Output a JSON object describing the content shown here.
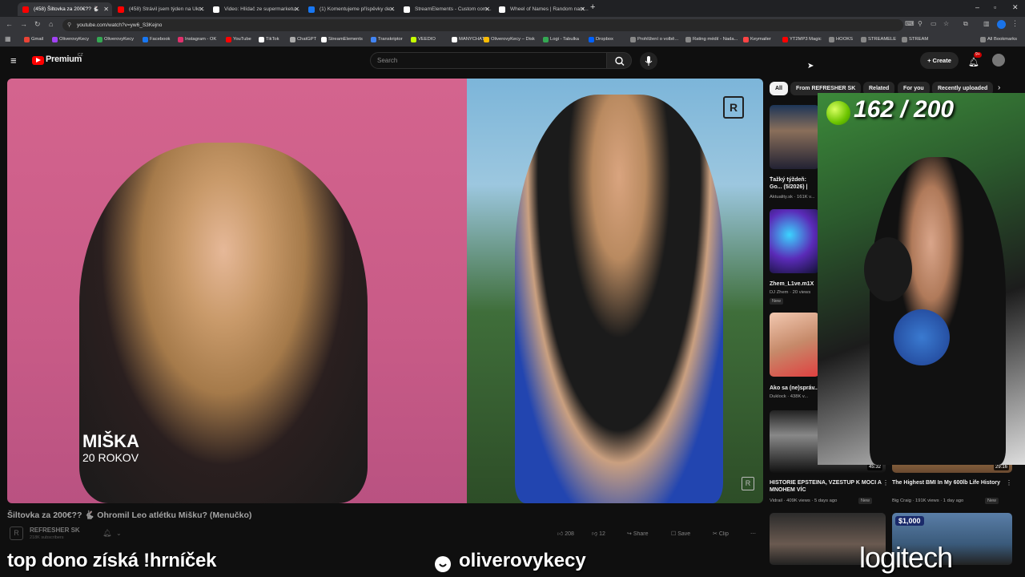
{
  "browser": {
    "tabs": [
      {
        "title": "(458) Šiltovka za 200€?? 🐇",
        "active": true,
        "color": "#ff0000"
      },
      {
        "title": "(458) Strávil jsem týden na Ukr...",
        "active": false,
        "color": "#ff0000"
      },
      {
        "title": "Video: Hlídač ze supermarketu...",
        "active": false,
        "color": "#ffffff"
      },
      {
        "title": "(1) Komentujeme příspěvky de...",
        "active": false,
        "color": "#1877f2"
      },
      {
        "title": "StreamElements - Custom com...",
        "active": false,
        "color": "#ffffff"
      },
      {
        "title": "Wheel of Names | Random nam...",
        "active": false,
        "color": "#ffffff"
      }
    ],
    "new_tab": "+",
    "url": "youtube.com/watch?v=yw6_S3Kejno",
    "bookmarks": [
      {
        "label": "Gmail",
        "color": "#ea4335"
      },
      {
        "label": "OliverovyKecy",
        "color": "#a142f4"
      },
      {
        "label": "OliverovyKecy",
        "color": "#34a853"
      },
      {
        "label": "Facebook",
        "color": "#1877f2"
      },
      {
        "label": "Instagram - OK",
        "color": "#e1306c"
      },
      {
        "label": "YouTube",
        "color": "#ff0000"
      },
      {
        "label": "TikTok",
        "color": "#ffffff"
      },
      {
        "label": "ChatGPT",
        "color": "#aaaaaa"
      },
      {
        "label": "StreamElements",
        "color": "#ffffff"
      },
      {
        "label": "Transkriptor",
        "color": "#4285f4"
      },
      {
        "label": "VEEDIO",
        "color": "#c6ff00"
      },
      {
        "label": "MANYCHAT",
        "color": "#ffffff"
      },
      {
        "label": "OliverovyKecy – Disk",
        "color": "#fbbc04"
      },
      {
        "label": "Logi - Tabulka",
        "color": "#34a853"
      },
      {
        "label": "Dropbox",
        "color": "#0061ff"
      },
      {
        "label": "Prohlížení o volbě...",
        "color": "#888888"
      },
      {
        "label": "Rating médií - Nada...",
        "color": "#888888"
      },
      {
        "label": "Keymailer",
        "color": "#ff4444"
      },
      {
        "label": "YT2MP3 Magic",
        "color": "#ff0000"
      },
      {
        "label": "HOOKS",
        "color": "#888888"
      },
      {
        "label": "STREAMELE",
        "color": "#888888"
      },
      {
        "label": "STREAM",
        "color": "#888888"
      }
    ],
    "all_bookmarks": "All Bookmarks"
  },
  "youtube": {
    "logo": "Premium",
    "region": "CZ",
    "search_placeholder": "Search",
    "create": "Create",
    "notif_count": "9+",
    "chips": [
      "All",
      "From REFRESHER SK",
      "Related",
      "For you",
      "Recently uploaded"
    ],
    "video": {
      "title": "Šiltovka za 200€?? 🐇 Ohromil Leo atlétku Mišku? (Menučko)",
      "channel": "REFRESHER SK",
      "subs": "218K subscribers",
      "likes": "208",
      "dislikes": "12",
      "share": "Share",
      "save": "Save",
      "clip": "Clip",
      "overlay_name": "MIŠKA",
      "overlay_age": "20 ROKOV"
    },
    "recs": [
      {
        "title": "Ťažký týždeň: Go... (5/2026) | Aktuali...",
        "meta": "Aktuality.sk · 161K v...",
        "badge": ""
      },
      {
        "title": "Zhem_L1ve.m1X",
        "meta": "DJ Zhem · 20 views",
        "badge": "New"
      },
      {
        "title": "Ako sa (ne)správ...",
        "meta": "Duklock · 438K v...",
        "badge": ""
      },
      {
        "title": "HISTORIE EPSTEINA, VZESTUP K MOCI A MNOHEM VÍC",
        "meta": "Vidrail · 409K views · 5 days ago",
        "badge": "New",
        "duration": "45:32"
      },
      {
        "title": "The Highest BMI In My 600lb Life History",
        "meta": "Big Craig · 191K views · 1 day ago",
        "badge": "New",
        "duration": "29:16"
      }
    ],
    "rec_price": "$1,000"
  },
  "stream": {
    "counter": "162 / 200",
    "bottom_left": "top dono získá !hrníček",
    "bottom_center": "oliverovykecy",
    "bottom_right": "logitech"
  }
}
